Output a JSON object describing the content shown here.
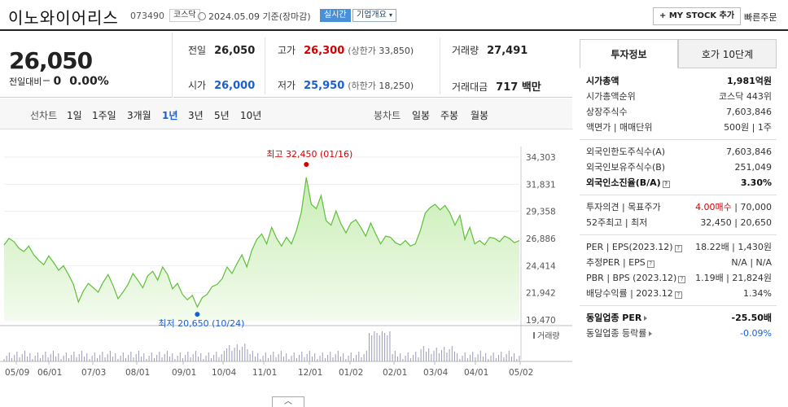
{
  "header": {
    "company": "이노와이어리스",
    "code": "073490",
    "market": "코스닥",
    "base_date": "2024.05.09 기준(장마감)",
    "live_label": "실시간",
    "overview_label": "기업개요",
    "overview_icon": "caret-down-icon",
    "mystock_label": "+ MY STOCK 추가",
    "quick_order_label": "빠른주문"
  },
  "price": {
    "current": "26,050",
    "change_label": "전일대비",
    "change_value": "0",
    "change_pct": "0.00%"
  },
  "stats": {
    "prev": {
      "label": "전일",
      "value": "26,050"
    },
    "high": {
      "label": "고가",
      "value": "26,300",
      "sub_label": "(상한가",
      "sub_value": "33,850)"
    },
    "volume": {
      "label": "거래량",
      "value": "27,491"
    },
    "open": {
      "label": "시가",
      "value": "26,000"
    },
    "low": {
      "label": "저가",
      "value": "25,950",
      "sub_label": "(하한가",
      "sub_value": "18,250)"
    },
    "amount": {
      "label": "거래대금",
      "value": "717 백만"
    }
  },
  "period_bar": {
    "line_label": "선차트",
    "line_items": [
      "1일",
      "1주일",
      "3개월",
      "1년",
      "3년",
      "5년",
      "10년"
    ],
    "active": "1년",
    "candle_label": "봉차트",
    "candle_items": [
      "일봉",
      "주봉",
      "월봉"
    ]
  },
  "chart_data": {
    "type": "area",
    "ylim": [
      19470,
      34303
    ],
    "yticks": [
      "34,303",
      "31,831",
      "29,358",
      "26,886",
      "24,414",
      "21,942",
      "19,470"
    ],
    "xticks": [
      "05/09",
      "06/01",
      "07/03",
      "08/01",
      "09/01",
      "10/04",
      "11/01",
      "12/01",
      "01/02",
      "02/01",
      "03/04",
      "04/01",
      "05/02"
    ],
    "values": [
      26300,
      26900,
      26600,
      26000,
      25700,
      26200,
      25400,
      24900,
      24500,
      25300,
      24700,
      24000,
      24400,
      23600,
      22700,
      21100,
      22100,
      22800,
      22400,
      22000,
      22900,
      23600,
      22600,
      21400,
      22000,
      22700,
      23700,
      23100,
      22400,
      23500,
      23900,
      23100,
      24300,
      23600,
      22300,
      22800,
      21800,
      21300,
      21700,
      20650,
      21500,
      21800,
      22500,
      22700,
      23200,
      24300,
      23700,
      24600,
      25400,
      24300,
      25800,
      26800,
      27300,
      26400,
      27900,
      26900,
      26200,
      27000,
      26400,
      27600,
      29300,
      32450,
      30000,
      29600,
      30800,
      28500,
      28100,
      29400,
      28200,
      27400,
      28300,
      28600,
      27900,
      27100,
      28300,
      27300,
      26400,
      27100,
      27000,
      26500,
      26300,
      26700,
      26200,
      26400,
      27600,
      29200,
      29700,
      30000,
      29500,
      29900,
      29200,
      28100,
      29000,
      26800,
      27900,
      26400,
      26700,
      26300,
      27000,
      26900,
      26600,
      27100,
      26900,
      26500,
      26700
    ],
    "high_annotation": {
      "label": "최고",
      "value": "32,450",
      "date": "(01/16)"
    },
    "low_annotation": {
      "label": "최저",
      "value": "20,650",
      "date": "(10/24)"
    },
    "volume_label": "거래량",
    "colors": {
      "line": "#5fbf3a",
      "fill_top": "#c8edb4",
      "fill_bottom": "#f3fbee",
      "high": "#d40000",
      "low": "#1a5fd1",
      "volume": "#9a9ab8"
    }
  },
  "side_panel": {
    "tab_invest": "투자정보",
    "tab_quote": "호가 10단계",
    "rows": [
      {
        "k": "시가총액",
        "v": "1,981억원",
        "bold": true
      },
      {
        "k": "시가총액순위",
        "v": "코스닥 443위"
      },
      {
        "k": "상장주식수",
        "v": "7,603,846"
      },
      {
        "k": "액면가 | 매매단위",
        "v": "500원 | 1주"
      },
      {
        "sep": true
      },
      {
        "k": "외국인한도주식수(A)",
        "v": "7,603,846"
      },
      {
        "k": "외국인보유주식수(B)",
        "v": "251,049"
      },
      {
        "k": "외국인소진율(B/A)",
        "v": "3.30%",
        "bold": true,
        "help": true
      },
      {
        "sep": true
      },
      {
        "k": "투자의견 | 목표주가",
        "v": "4.00매수 | 70,000",
        "red_part": "4.00매수"
      },
      {
        "k": "52주최고 | 최저",
        "v": "32,450 | 20,650"
      },
      {
        "sep": true
      },
      {
        "k": "PER | EPS(2023.12)",
        "v": "18.22배 | 1,430원",
        "help": true
      },
      {
        "k": "추정PER | EPS",
        "v": "N/A | N/A",
        "help": true
      },
      {
        "k": "PBR | BPS (2023.12)",
        "v": "1.19배 | 21,824원",
        "help": true
      },
      {
        "k": "배당수익률 | 2023.12",
        "v": "1.34%",
        "help": true
      },
      {
        "sep": true
      },
      {
        "k": "동일업종 PER",
        "v": "-25.50배",
        "bold": true,
        "tri": true
      },
      {
        "k": "동일업종 등락률",
        "v": "-0.09%",
        "blue": true,
        "tri": true
      }
    ]
  },
  "collapse_icon": "chevron-up-icon"
}
